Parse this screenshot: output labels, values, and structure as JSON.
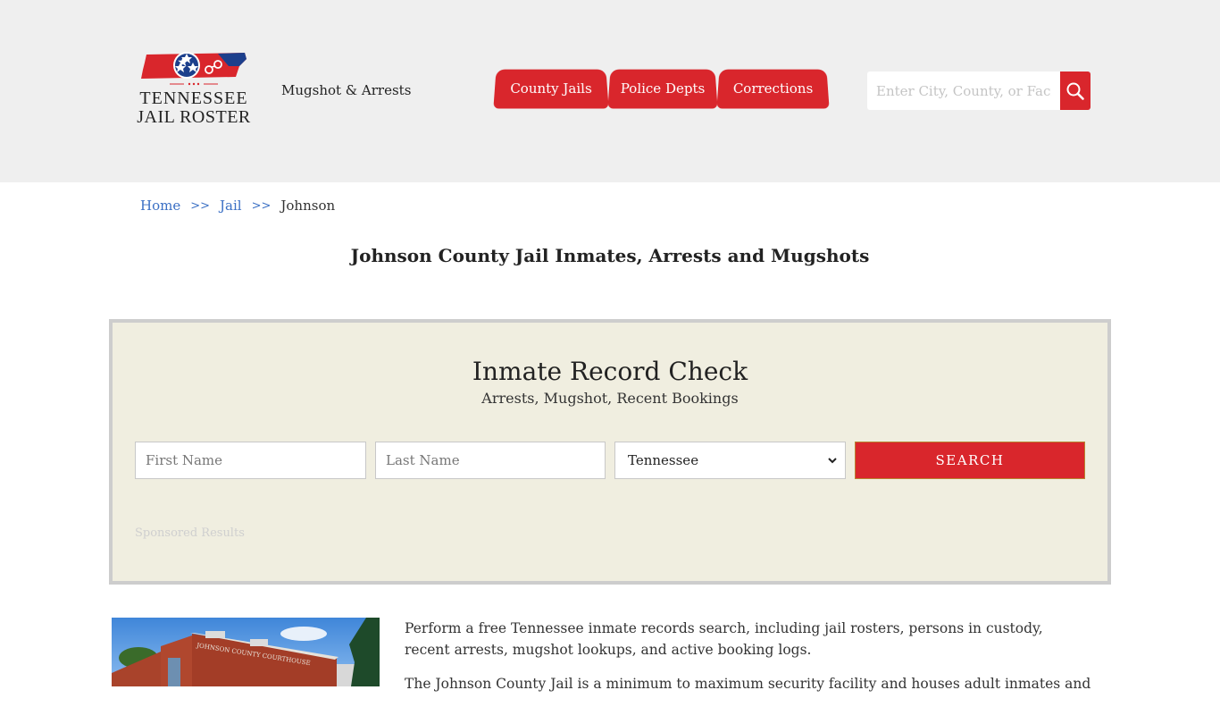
{
  "header": {
    "logo": {
      "line1": "TENNESSEE",
      "line2": "JAIL ROSTER",
      "colors": {
        "red": "#d9262c",
        "blue": "#1c3f8c"
      }
    },
    "tagline": "Mugshot & Arrests",
    "nav": [
      {
        "label": "County Jails"
      },
      {
        "label": "Police Depts"
      },
      {
        "label": "Corrections"
      }
    ],
    "search": {
      "placeholder": "Enter City, County, or Facility",
      "icon": "search-icon"
    }
  },
  "breadcrumb": {
    "items": [
      {
        "label": "Home"
      },
      {
        "label": "Jail"
      }
    ],
    "separator": ">>",
    "current": "Johnson"
  },
  "page_title": "Johnson County Jail Inmates, Arrests and Mugshots",
  "record_check": {
    "title": "Inmate Record Check",
    "subtitle": "Arrests, Mugshot, Recent Bookings",
    "first_name_placeholder": "First Name",
    "last_name_placeholder": "Last Name",
    "state_selected": "Tennessee",
    "search_label": "SEARCH",
    "sponsored_label": "Sponsored Results"
  },
  "content": {
    "photo_alt": "Johnson County Courthouse",
    "photo_sign": "JOHNSON COUNTY COURTHOUSE",
    "paragraphs": [
      "Perform a free Tennessee inmate records search, including jail rosters, persons in custody, recent arrests, mugshot lookups, and active booking logs.",
      "The Johnson County Jail is a minimum to maximum security facility and houses adult inmates and"
    ]
  },
  "colors": {
    "accent": "#d9262c",
    "header_bg": "#efefef",
    "box_bg": "#f0eee0",
    "link": "#3a6fc4"
  }
}
